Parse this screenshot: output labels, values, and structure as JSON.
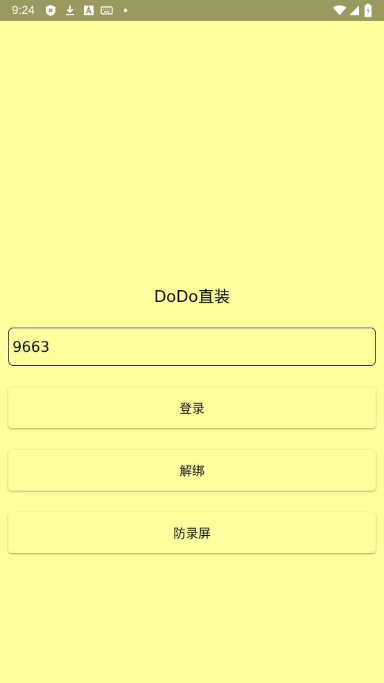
{
  "status_bar": {
    "time": "9:24",
    "icons_left": [
      "shield-icon",
      "download-icon",
      "font-a-icon",
      "keyboard-icon",
      "dot-icon"
    ],
    "icons_right": [
      "wifi-icon",
      "signal-icon",
      "battery-icon"
    ]
  },
  "app": {
    "title": "DoDo直装",
    "input_value": "9663",
    "buttons": {
      "login": "登录",
      "unbind": "解绑",
      "anti_record": "防录屏"
    }
  },
  "colors": {
    "background": "#FFFF9E",
    "status_bar": "#9A9A60"
  }
}
